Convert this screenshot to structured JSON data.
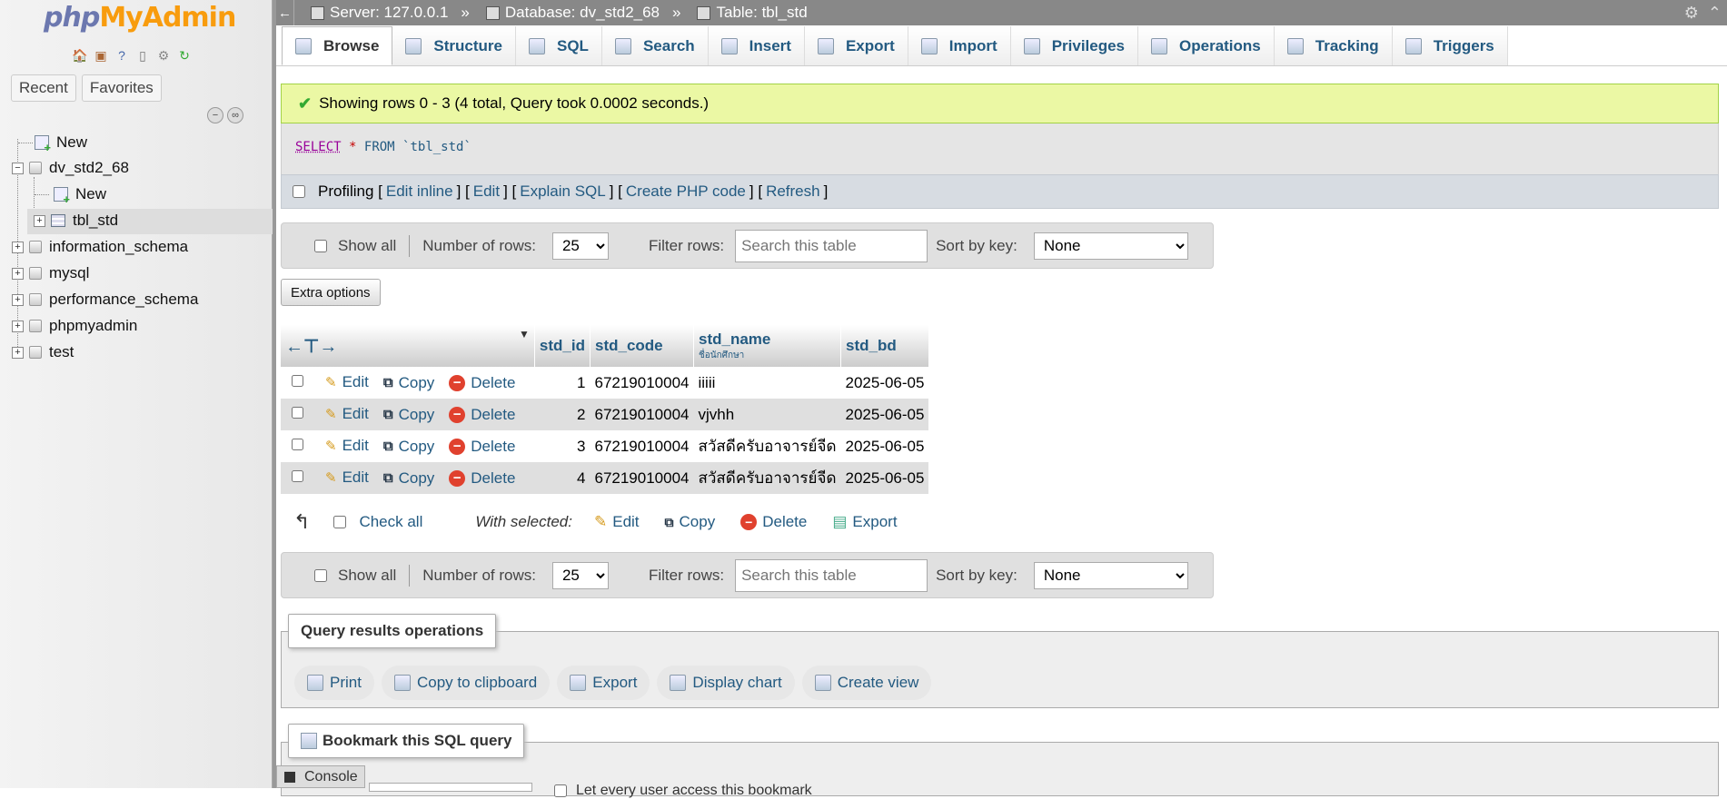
{
  "nav": {
    "logo_php": "php",
    "logo_myadmin": "MyAdmin",
    "tabs": [
      "Recent",
      "Favorites"
    ],
    "tree": {
      "new_root": "New",
      "db_current": "dv_std2_68",
      "db_new": "New",
      "db_table": "tbl_std",
      "databases": [
        "information_schema",
        "mysql",
        "performance_schema",
        "phpmyadmin",
        "test"
      ]
    }
  },
  "topbar": {
    "server": "Server: 127.0.0.1",
    "database": "Database: dv_std2_68",
    "table": "Table: tbl_std",
    "separator": "»"
  },
  "tabs": [
    "Browse",
    "Structure",
    "SQL",
    "Search",
    "Insert",
    "Export",
    "Import",
    "Privileges",
    "Operations",
    "Tracking",
    "Triggers"
  ],
  "active_tab": "Browse",
  "message": "Showing rows 0 - 3 (4 total, Query took 0.0002 seconds.)",
  "sql": {
    "select": "SELECT",
    "star": "*",
    "rest": "FROM `tbl_std`"
  },
  "profiling": {
    "label": "Profiling",
    "links": [
      "Edit inline",
      "Edit",
      "Explain SQL",
      "Create PHP code",
      "Refresh"
    ]
  },
  "navbar": {
    "show_all": "Show all",
    "num_rows_label": "Number of rows:",
    "num_rows_value": "25",
    "filter_label": "Filter rows:",
    "filter_placeholder": "Search this table",
    "sort_label": "Sort by key:",
    "sort_value": "None"
  },
  "extra_options": "Extra options",
  "table": {
    "columns": [
      "std_id",
      "std_code",
      "std_name",
      "std_bd"
    ],
    "std_name_comment": "ชื่อนักศึกษา",
    "action_labels": {
      "edit": "Edit",
      "copy": "Copy",
      "delete": "Delete"
    },
    "rows": [
      {
        "std_id": "1",
        "std_code": "67219010004",
        "std_name": "iiiii",
        "std_bd": "2025-06-05"
      },
      {
        "std_id": "2",
        "std_code": "67219010004",
        "std_name": "vjvhh",
        "std_bd": "2025-06-05"
      },
      {
        "std_id": "3",
        "std_code": "67219010004",
        "std_name": "สวัสดีครับอาจารย์จีด",
        "std_bd": "2025-06-05"
      },
      {
        "std_id": "4",
        "std_code": "67219010004",
        "std_name": "สวัสดีครับอาจารย์จีด",
        "std_bd": "2025-06-05"
      }
    ]
  },
  "bulk": {
    "check_all": "Check all",
    "with_selected": "With selected:",
    "actions": [
      "Edit",
      "Copy",
      "Delete",
      "Export"
    ]
  },
  "query_ops": {
    "legend": "Query results operations",
    "buttons": [
      "Print",
      "Copy to clipboard",
      "Export",
      "Display chart",
      "Create view"
    ]
  },
  "bookmark": {
    "legend": "Bookmark this SQL query",
    "checkbox_label": "Let every user access this bookmark"
  },
  "console": "Console"
}
